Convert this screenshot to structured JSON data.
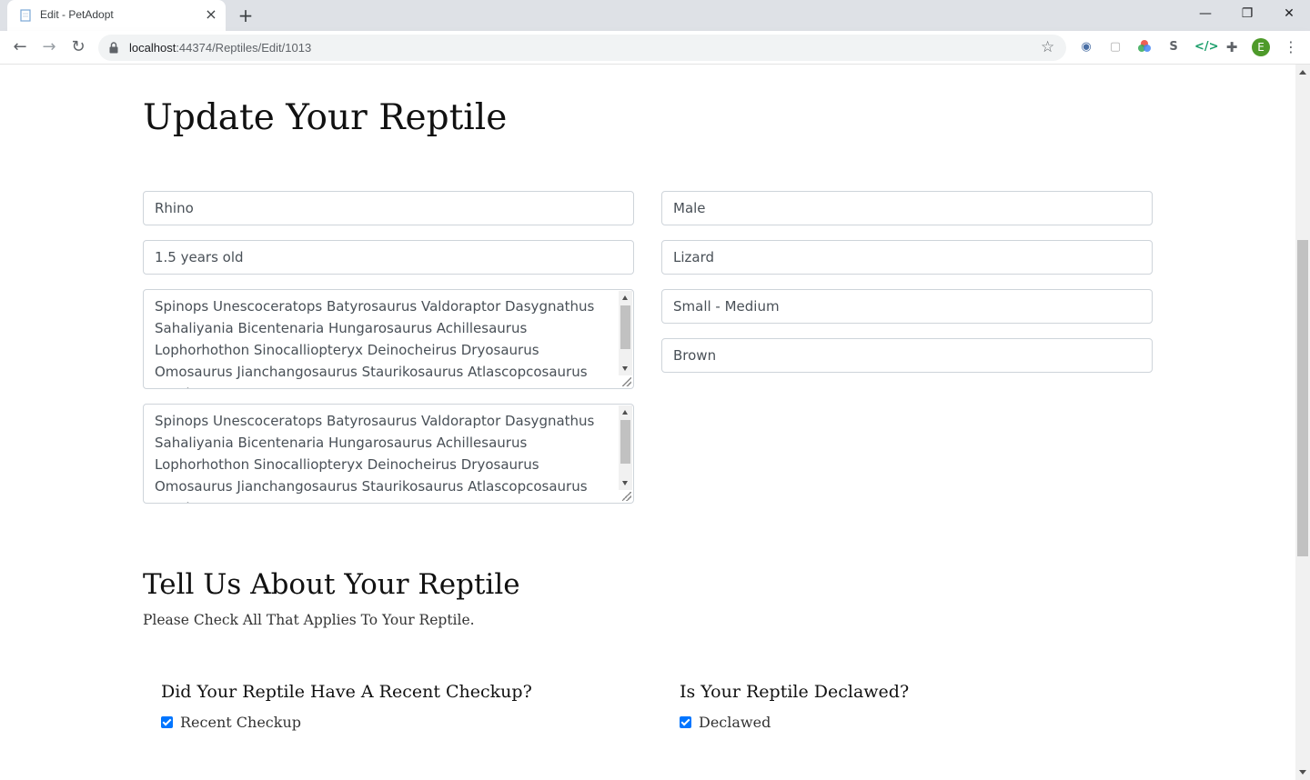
{
  "browser": {
    "tab_title": "Edit - PetAdopt",
    "url_host": "localhost",
    "url_rest": ":44374/Reptiles/Edit/1013",
    "profile_initial": "E",
    "extensions": [
      "translate-icon",
      "frame-icon",
      "color-wheel-icon",
      "s-icon",
      "code-icon",
      "puzzle-icon"
    ]
  },
  "page": {
    "title": "Update Your Reptile",
    "fields": {
      "name": "Rhino",
      "age": "1.5 years old",
      "gender": "Male",
      "species": "Lizard",
      "size": "Small - Medium",
      "color": "Brown",
      "description_1": "Spinops Unescoceratops Batyrosaurus Valdoraptor Dasygnathus Sahaliyania Bicentenaria Hungarosaurus Achillesaurus Lophorhothon Sinocalliopteryx Deinocheirus Dryosaurus Omosaurus Jianchangosaurus Staurikosaurus Atlascopcosaurus Anodontosaurus",
      "description_2": "Spinops Unescoceratops Batyrosaurus Valdoraptor Dasygnathus Sahaliyania Bicentenaria Hungarosaurus Achillesaurus Lophorhothon Sinocalliopteryx Deinocheirus Dryosaurus Omosaurus Jianchangosaurus Staurikosaurus Atlascopcosaurus Anodontosaurus"
    },
    "section_title": "Tell Us About Your Reptile",
    "section_subtitle": "Please Check All That Applies To Your Reptile.",
    "questions": [
      {
        "title": "Did Your Reptile Have A Recent Checkup?",
        "label": "Recent Checkup",
        "checked": true
      },
      {
        "title": "Is Your Reptile Declawed?",
        "label": "Declawed",
        "checked": true
      }
    ]
  },
  "colors": {
    "accent": "#0075ff",
    "border": "#ced4da",
    "profile": "#4e9a2a"
  }
}
